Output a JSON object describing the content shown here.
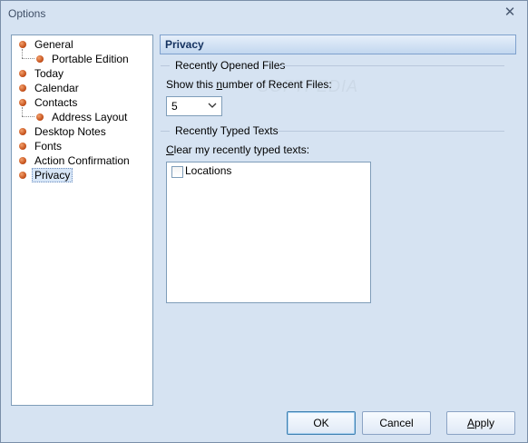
{
  "window": {
    "title": "Options",
    "close_glyph": "✕"
  },
  "tree": {
    "items": [
      {
        "label": "General",
        "level": 0
      },
      {
        "label": "Portable Edition",
        "level": 1
      },
      {
        "label": "Today",
        "level": 0
      },
      {
        "label": "Calendar",
        "level": 0
      },
      {
        "label": "Contacts",
        "level": 0
      },
      {
        "label": "Address Layout",
        "level": 1
      },
      {
        "label": "Desktop Notes",
        "level": 0
      },
      {
        "label": "Fonts",
        "level": 0
      },
      {
        "label": "Action Confirmation",
        "level": 0
      },
      {
        "label": "Privacy",
        "level": 0,
        "selected": true
      }
    ]
  },
  "panel": {
    "title": "Privacy",
    "recent_files": {
      "group_title": "Recently Opened Files",
      "label_prefix": "Show this ",
      "label_underlined": "n",
      "label_suffix": "umber of Recent Files:",
      "value": "5",
      "chevron_icon": "chevron-down-icon"
    },
    "typed_texts": {
      "group_title": "Recently Typed Texts",
      "label_prefix": "",
      "label_underlined": "C",
      "label_suffix": "lear my recently typed texts:",
      "items": [
        {
          "label": "Locations",
          "checked": false
        }
      ]
    }
  },
  "watermark": "SOFTPEDIA",
  "buttons": {
    "ok": "OK",
    "cancel": "Cancel",
    "apply_underlined": "A",
    "apply_rest": "pply"
  },
  "colors": {
    "accent": "#13315f",
    "window_bg": "#d6e3f2",
    "bullet": "#c4501a"
  }
}
